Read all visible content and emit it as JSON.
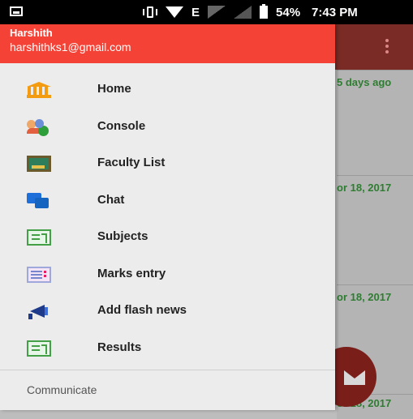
{
  "status_bar": {
    "network": "E",
    "battery_percent": "54%",
    "time": "7:43 PM"
  },
  "drawer": {
    "user_name": "Harshith",
    "user_email": "harshithks1@gmail.com",
    "items": [
      {
        "label": "Home",
        "icon": "bank-icon"
      },
      {
        "label": "Console",
        "icon": "users-add-icon"
      },
      {
        "label": "Faculty List",
        "icon": "blackboard-icon"
      },
      {
        "label": "Chat",
        "icon": "chat-bubbles-icon"
      },
      {
        "label": "Subjects",
        "icon": "book-list-icon"
      },
      {
        "label": "Marks entry",
        "icon": "checklist-icon"
      },
      {
        "label": "Add flash news",
        "icon": "megaphone-icon"
      },
      {
        "label": "Results",
        "icon": "book-list-icon"
      }
    ],
    "section_header": "Communicate"
  },
  "background": {
    "dates": [
      "5 days ago",
      "or 18, 2017",
      "or 18, 2017",
      "or 18, 2017"
    ]
  },
  "colors": {
    "drawer_header": "#f44336",
    "app_bar": "#7a2b26",
    "date_text": "#2e7d32",
    "fab": "#7a1e1a"
  }
}
